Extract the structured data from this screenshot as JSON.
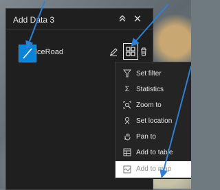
{
  "panel": {
    "title": "Add Data 3",
    "collapse_icon": "double-chevron-up-icon",
    "close_icon": "close-icon"
  },
  "layer": {
    "name": "IceRoad",
    "swatch_color": "#0b84d8",
    "icons": [
      "edit-pencil-icon",
      "actions-menu-icon",
      "delete-trash-icon"
    ]
  },
  "context_menu": {
    "items": [
      {
        "label": "Set filter",
        "icon": "filter-icon",
        "enabled": true
      },
      {
        "label": "Statistics",
        "icon": "sigma-icon",
        "enabled": true
      },
      {
        "label": "Zoom to",
        "icon": "zoom-to-icon",
        "enabled": true
      },
      {
        "label": "Set location",
        "icon": "set-location-icon",
        "enabled": true
      },
      {
        "label": "Pan to",
        "icon": "hand-icon",
        "enabled": true
      },
      {
        "label": "Add to table",
        "icon": "table-icon",
        "enabled": true
      },
      {
        "label": "Add to map",
        "icon": "map-icon",
        "enabled": false
      }
    ]
  },
  "colors": {
    "panel_bg": "#1f1f1f",
    "accent_blue": "#0b84d8",
    "annotation_arrow": "#2f7fd6"
  }
}
